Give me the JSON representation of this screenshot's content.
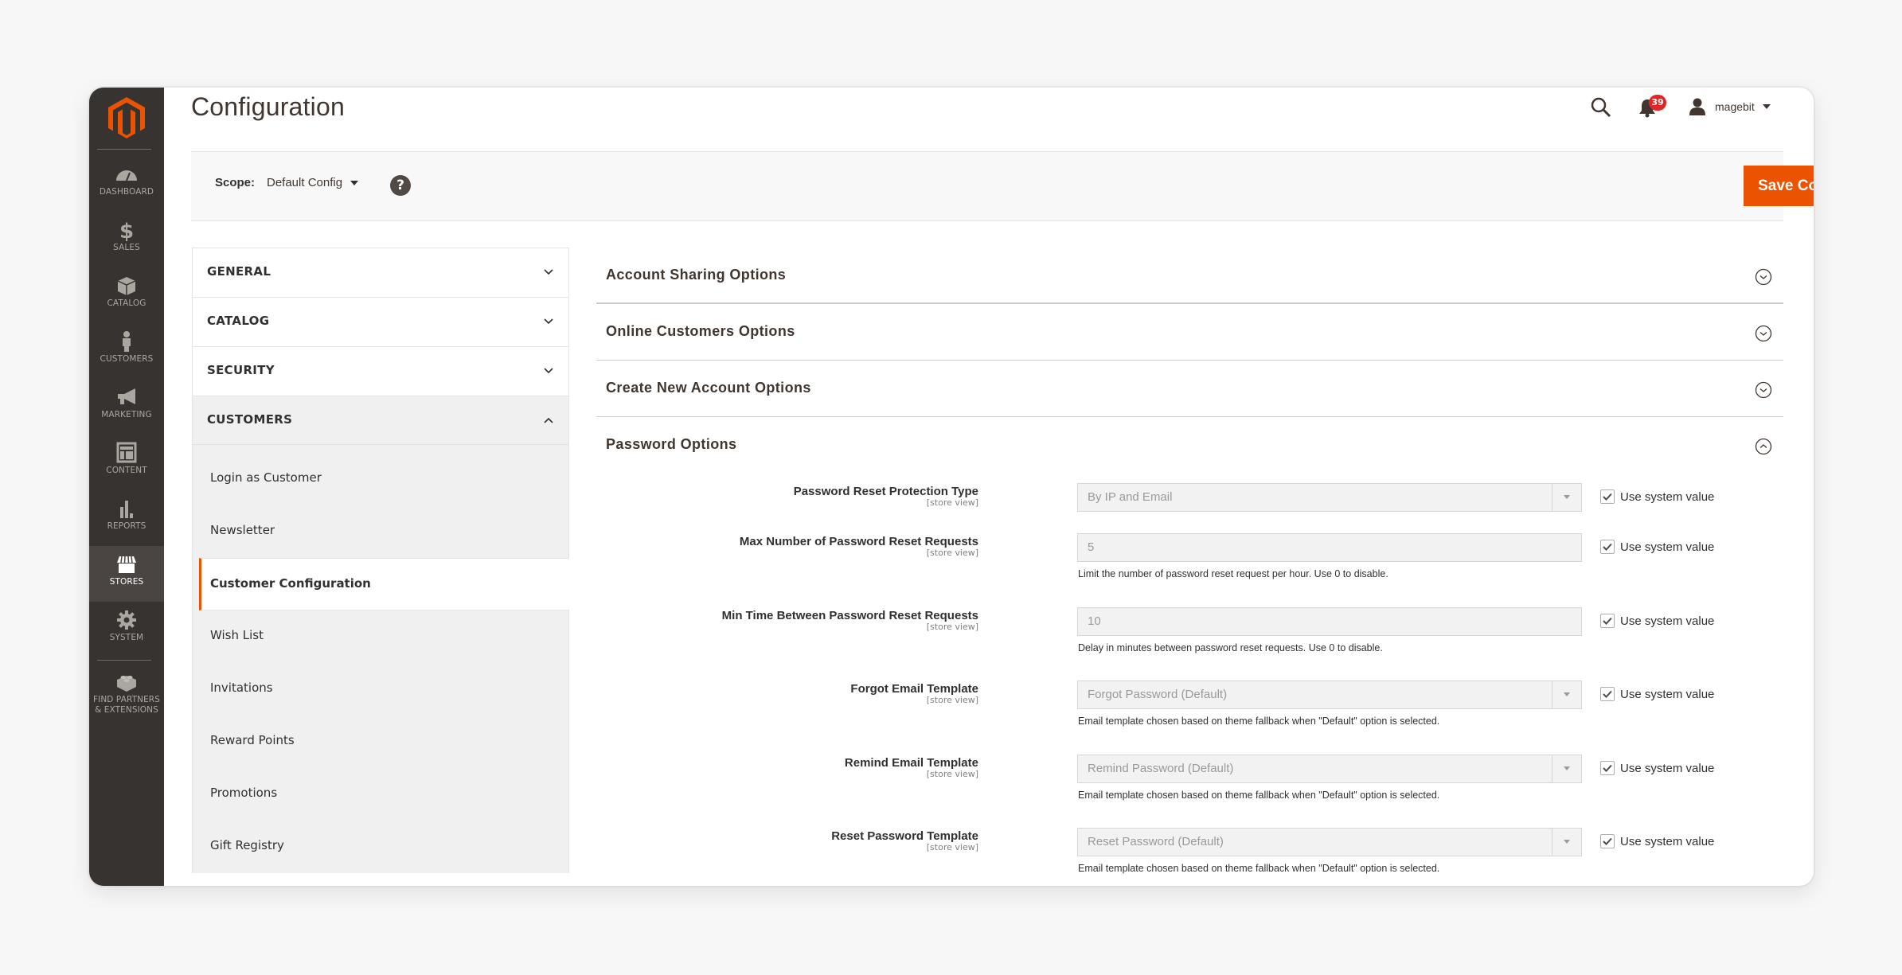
{
  "sidebar": {
    "logo": "magento-logo",
    "items": [
      {
        "label": "DASHBOARD",
        "icon": "dashboard-gauge-icon",
        "active": false
      },
      {
        "label": "SALES",
        "icon": "dollar-icon",
        "active": false
      },
      {
        "label": "CATALOG",
        "icon": "box-icon",
        "active": false
      },
      {
        "label": "CUSTOMERS",
        "icon": "person-icon",
        "active": false
      },
      {
        "label": "MARKETING",
        "icon": "megaphone-icon",
        "active": false
      },
      {
        "label": "CONTENT",
        "icon": "layout-icon",
        "active": false
      },
      {
        "label": "REPORTS",
        "icon": "bar-chart-icon",
        "active": false
      },
      {
        "label": "STORES",
        "icon": "storefront-icon",
        "active": true
      },
      {
        "label": "SYSTEM",
        "icon": "gear-icon",
        "active": false
      }
    ],
    "partners": {
      "line1": "FIND PARTNERS",
      "line2": "& EXTENSIONS",
      "icon": "lego-brick-icon"
    }
  },
  "header": {
    "title": "Configuration",
    "notifications_count": "39",
    "username": "magebit"
  },
  "scope": {
    "label": "Scope:",
    "value": "Default Config",
    "help": "?",
    "save_label": "Save Config"
  },
  "colors": {
    "accent": "#eb5202",
    "sidebar_bg": "#373330",
    "badge": "#e22626"
  },
  "config_nav": {
    "tabs": [
      {
        "label": "GENERAL",
        "open": false
      },
      {
        "label": "CATALOG",
        "open": false
      },
      {
        "label": "SECURITY",
        "open": false
      },
      {
        "label": "CUSTOMERS",
        "open": true
      }
    ],
    "customers_items": [
      {
        "label": "Login as Customer",
        "active": false
      },
      {
        "label": "Newsletter",
        "active": false
      },
      {
        "label": "Customer Configuration",
        "active": true
      },
      {
        "label": "Wish List",
        "active": false
      },
      {
        "label": "Invitations",
        "active": false
      },
      {
        "label": "Reward Points",
        "active": false
      },
      {
        "label": "Promotions",
        "active": false
      },
      {
        "label": "Gift Registry",
        "active": false
      }
    ]
  },
  "sections": [
    {
      "title": "Account Sharing Options",
      "expanded": false
    },
    {
      "title": "Online Customers Options",
      "expanded": false
    },
    {
      "title": "Create New Account Options",
      "expanded": false
    },
    {
      "title": "Password Options",
      "expanded": true
    }
  ],
  "password_options": {
    "use_system_value_label": "Use system value",
    "fields": [
      {
        "label": "Password Reset Protection Type",
        "scope": "[store view]",
        "type": "select",
        "value": "By IP and Email",
        "note": "",
        "use_system_value": true
      },
      {
        "label": "Max Number of Password Reset Requests",
        "scope": "[store view]",
        "type": "text",
        "value": "5",
        "note": "Limit the number of password reset request per hour. Use 0 to disable.",
        "use_system_value": true
      },
      {
        "label": "Min Time Between Password Reset Requests",
        "scope": "[store view]",
        "type": "text",
        "value": "10",
        "note": "Delay in minutes between password reset requests. Use 0 to disable.",
        "use_system_value": true
      },
      {
        "label": "Forgot Email Template",
        "scope": "[store view]",
        "type": "select",
        "value": "Forgot Password (Default)",
        "note": "Email template chosen based on theme fallback when \"Default\" option is selected.",
        "use_system_value": true
      },
      {
        "label": "Remind Email Template",
        "scope": "[store view]",
        "type": "select",
        "value": "Remind Password (Default)",
        "note": "Email template chosen based on theme fallback when \"Default\" option is selected.",
        "use_system_value": true
      },
      {
        "label": "Reset Password Template",
        "scope": "[store view]",
        "type": "select",
        "value": "Reset Password (Default)",
        "note": "Email template chosen based on theme fallback when \"Default\" option is selected.",
        "use_system_value": true
      }
    ]
  }
}
